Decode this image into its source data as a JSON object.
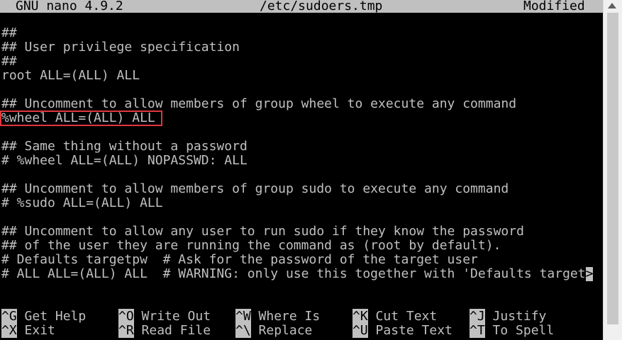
{
  "title_bar": {
    "app": "GNU nano 4.9.2",
    "file": "/etc/sudoers.tmp",
    "status": "Modified"
  },
  "editor": {
    "lines": [
      "##",
      "## User privilege specification",
      "##",
      "root ALL=(ALL) ALL",
      "",
      "## Uncomment to allow members of group wheel to execute any command",
      "%wheel ALL=(ALL) ALL",
      "",
      "## Same thing without a password",
      "# %wheel ALL=(ALL) NOPASSWD: ALL",
      "",
      "## Uncomment to allow members of group sudo to execute any command",
      "# %sudo ALL=(ALL) ALL",
      "",
      "## Uncomment to allow any user to run sudo if they know the password",
      "## of the user they are running the command as (root by default).",
      "# Defaults targetpw  # Ask for the password of the target user",
      "# ALL ALL=(ALL) ALL  # WARNING: only use this together with 'Defaults target"
    ],
    "overflow_marker": ">"
  },
  "shortcuts": {
    "row1": [
      {
        "key": "^G",
        "label": "Get Help"
      },
      {
        "key": "^O",
        "label": "Write Out"
      },
      {
        "key": "^W",
        "label": "Where Is"
      },
      {
        "key": "^K",
        "label": "Cut Text"
      },
      {
        "key": "^J",
        "label": "Justify"
      }
    ],
    "row2": [
      {
        "key": "^X",
        "label": "Exit"
      },
      {
        "key": "^R",
        "label": "Read File"
      },
      {
        "key": "^\\",
        "label": "Replace"
      },
      {
        "key": "^U",
        "label": "Paste Text"
      },
      {
        "key": "^T",
        "label": "To Spell"
      }
    ]
  },
  "colors": {
    "background": "#000000",
    "foreground": "#c0c0c0",
    "highlight_border": "#e0373c"
  }
}
